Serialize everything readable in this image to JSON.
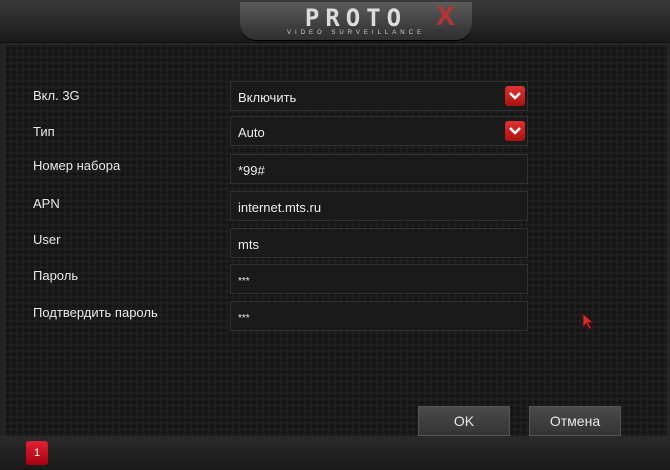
{
  "header": {
    "logo_text": "PROTO",
    "logo_mark": "X",
    "logo_subtitle": "VIDEO SURVEILLANCE"
  },
  "form": {
    "enable_3g_label": "Вкл. 3G",
    "enable_3g_value": "Включить",
    "type_label": "Тип",
    "type_value": "Auto",
    "dial_number_label": "Номер набора",
    "dial_number_value": "*99#",
    "apn_label": "APN",
    "apn_value": "internet.mts.ru",
    "user_label": "User",
    "user_value": "mts",
    "password_label": "Пароль",
    "password_value": "***",
    "confirm_password_label": "Подтвердить пароль",
    "confirm_password_value": "***"
  },
  "buttons": {
    "ok": "OK",
    "cancel": "Отмена"
  },
  "footer": {
    "notification_count": "1"
  },
  "colors": {
    "accent": "#cc2222",
    "panel": "#151515"
  },
  "icons": {
    "dropdown": "chevron-down-icon",
    "cursor": "mouse-pointer-icon",
    "notification": "notification-icon"
  }
}
